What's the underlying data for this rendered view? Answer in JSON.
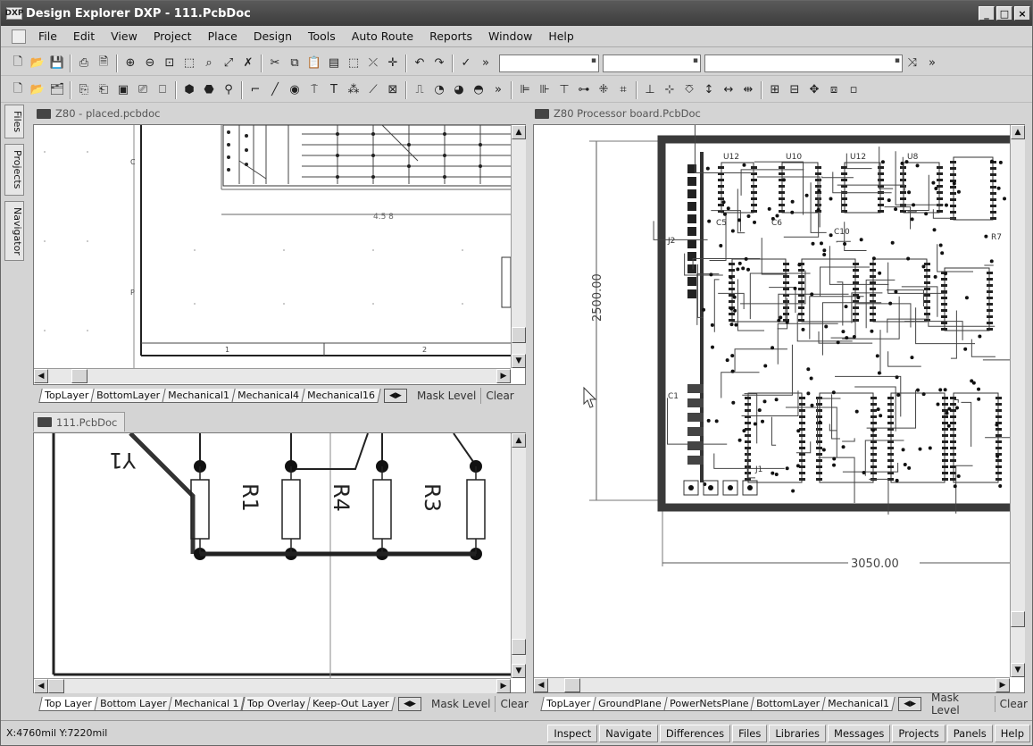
{
  "window": {
    "title": "Design Explorer DXP - 111.PcbDoc",
    "app_icon_label": "DXP"
  },
  "menu": [
    "File",
    "Edit",
    "View",
    "Project",
    "Place",
    "Design",
    "Tools",
    "Auto Route",
    "Reports",
    "Window",
    "Help"
  ],
  "side_panels": [
    "Files",
    "Projects",
    "Navigator"
  ],
  "docs": {
    "top_left": {
      "title": "Z80 - placed.pcbdoc",
      "layers": [
        "TopLayer",
        "BottomLayer",
        "Mechanical1",
        "Mechanical4",
        "Mechanical16"
      ],
      "drawing_labels": {
        "c": "C",
        "p": "P",
        "n1": "1",
        "n2": "2",
        "dim": "4.5 8"
      }
    },
    "bottom_left": {
      "title": "111.PcbDoc",
      "layers": [
        "Top Layer",
        "Bottom Layer",
        "Mechanical 1",
        "Top Overlay",
        "Keep-Out Layer"
      ],
      "components": [
        "Y1",
        "R1",
        "R4",
        "R3"
      ]
    },
    "right": {
      "title": "Z80 Processor board.PcbDoc",
      "layers": [
        "TopLayer",
        "GroundPlane",
        "PowerNetsPlane",
        "BottomLayer",
        "Mechanical1"
      ],
      "dim_vertical": "2500.00",
      "dim_horizontal": "3050.00",
      "ic_labels": [
        "U12",
        "U10",
        "U12",
        "U8",
        "C5",
        "C6",
        "C10",
        "C1",
        "J2",
        "J1",
        "R7"
      ]
    }
  },
  "layerbar": {
    "mask_level": "Mask Level",
    "clear": "Clear"
  },
  "status": {
    "coords": "X:4760mil Y:7220mil",
    "panels": [
      "Inspect",
      "Navigate",
      "Differences",
      "Files",
      "Libraries",
      "Messages",
      "Projects",
      "Panels",
      "Help"
    ]
  },
  "colors": {
    "titlebar": "#444444",
    "pcb_border": "#3a3a3a",
    "trace": "#222222"
  }
}
